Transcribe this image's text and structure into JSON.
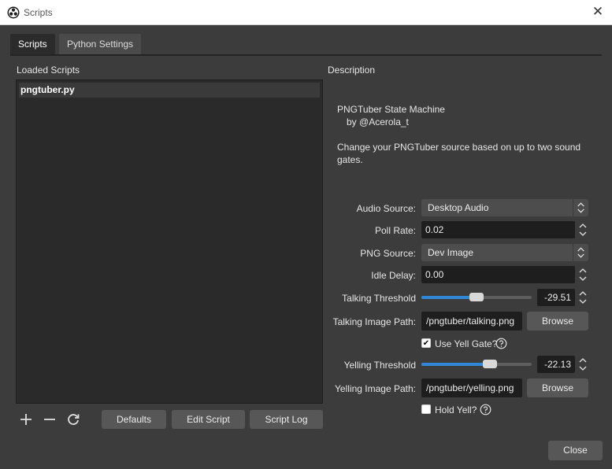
{
  "window": {
    "title": "Scripts",
    "close_glyph": "✕"
  },
  "tabs": [
    {
      "label": "Scripts",
      "active": true
    },
    {
      "label": "Python Settings",
      "active": false
    }
  ],
  "loaded_scripts": {
    "heading": "Loaded Scripts",
    "items": [
      "pngtuber.py"
    ]
  },
  "script_controls": {
    "add_icon": "plus-icon",
    "remove_icon": "minus-icon",
    "reload_icon": "refresh-icon",
    "defaults_label": "Defaults",
    "edit_label": "Edit Script",
    "log_label": "Script Log"
  },
  "description": {
    "heading": "Description",
    "line1": "PNGTuber State Machine",
    "line2": "by @Acerola_t",
    "body_line1": "Change your PNGTuber source based on up to two sound",
    "body_line2": "gates."
  },
  "settings": {
    "audio_source_label": "Audio Source:",
    "audio_source_value": "Desktop Audio",
    "poll_rate_label": "Poll Rate:",
    "poll_rate_value": "0.02",
    "png_source_label": "PNG Source:",
    "png_source_value": "Dev Image",
    "idle_delay_label": "Idle Delay:",
    "idle_delay_value": "0.00",
    "talking_threshold_label": "Talking Threshold",
    "talking_threshold_value": "-29.51",
    "talking_threshold_level": 0.5,
    "talking_image_label": "Talking Image Path:",
    "talking_image_value": "/pngtuber/talking.png",
    "browse_label": "Browse",
    "use_yell_gate_label": "Use Yell Gate?",
    "use_yell_gate_checked": true,
    "yelling_threshold_label": "Yelling Threshold",
    "yelling_threshold_value": "-22.13",
    "yelling_threshold_level": 0.62,
    "yelling_image_label": "Yelling Image Path:",
    "yelling_image_value": "/pngtuber/yelling.png",
    "hold_yell_label": "Hold Yell?",
    "hold_yell_checked": false
  },
  "footer": {
    "close_label": "Close"
  },
  "colors": {
    "accent": "#2f87d6",
    "background": "#3c3c3c",
    "input_bg": "#1e1e1e"
  }
}
